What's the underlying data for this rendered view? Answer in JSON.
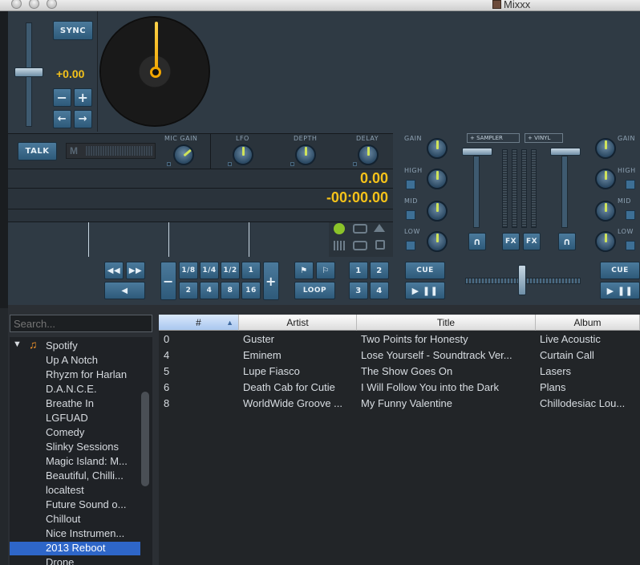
{
  "window": {
    "title": "Mixxx"
  },
  "deck": {
    "sync_label": "SYNC",
    "pitch_value": "+0.00",
    "minus_label": "−",
    "plus_label": "+",
    "left_arrow": "←",
    "right_arrow": "→",
    "position_value": "0.00",
    "time_remaining": "-00:00.00"
  },
  "mic": {
    "talk_label": "TALK",
    "m_label": "M",
    "mic_gain_label": "MIC GAIN"
  },
  "effects": {
    "lfo_label": "LFO",
    "depth_label": "DEPTH",
    "delay_label": "DELAY"
  },
  "mixer": {
    "gain_label": "GAIN",
    "high_label": "HIGH",
    "mid_label": "MID",
    "low_label": "LOW",
    "sampler_label": "+ SAMPLER",
    "vinyl_label": "+ VINYL",
    "fx_label": "FX"
  },
  "transport": {
    "rewind_label": "◀◀",
    "ffwd_label": "▶▶",
    "reverse_label": "◀",
    "loop_minus": "−",
    "loop_plus": "+",
    "loop_sizes_top": [
      "1/8",
      "1/4",
      "1/2",
      "1"
    ],
    "loop_sizes_bottom": [
      "2",
      "4",
      "8",
      "16"
    ],
    "loop_label": "LOOP",
    "hotcues": [
      "1",
      "2",
      "3",
      "4"
    ],
    "cue_label": "CUE",
    "play_label": "▶ ❚❚",
    "cue_label_right": "CUE",
    "play_label_right": "▶ ❚❚"
  },
  "library": {
    "search_placeholder": "Search...",
    "sidebar": {
      "root": "Spotify",
      "items": [
        "Up A Notch",
        "Rhyzm for Harlan",
        "D.A.N.C.E.",
        "Breathe In",
        "LGFUAD",
        "Comedy",
        "Slinky Sessions",
        "Magic Island: M...",
        "Beautiful, Chilli...",
        "localtest",
        "Future Sound o...",
        "Chillout",
        "Nice Instrumen...",
        "2013 Reboot",
        "Drone"
      ],
      "selected": "2013 Reboot"
    },
    "columns": [
      "#",
      "Artist",
      "Title",
      "Album"
    ],
    "rows": [
      {
        "num": "0",
        "artist": "Guster",
        "title": "Two Points for Honesty",
        "album": "Live Acoustic"
      },
      {
        "num": "4",
        "artist": "Eminem",
        "title": "Lose Yourself - Soundtrack Ver...",
        "album": "Curtain Call"
      },
      {
        "num": "5",
        "artist": "Lupe Fiasco",
        "title": "The Show Goes On",
        "album": "Lasers"
      },
      {
        "num": "6",
        "artist": "Death Cab for Cutie",
        "title": "I Will Follow You into the Dark",
        "album": "Plans"
      },
      {
        "num": "8",
        "artist": "WorldWide Groove ...",
        "title": "My Funny Valentine",
        "album": "Chillodesiac Lou..."
      }
    ]
  }
}
